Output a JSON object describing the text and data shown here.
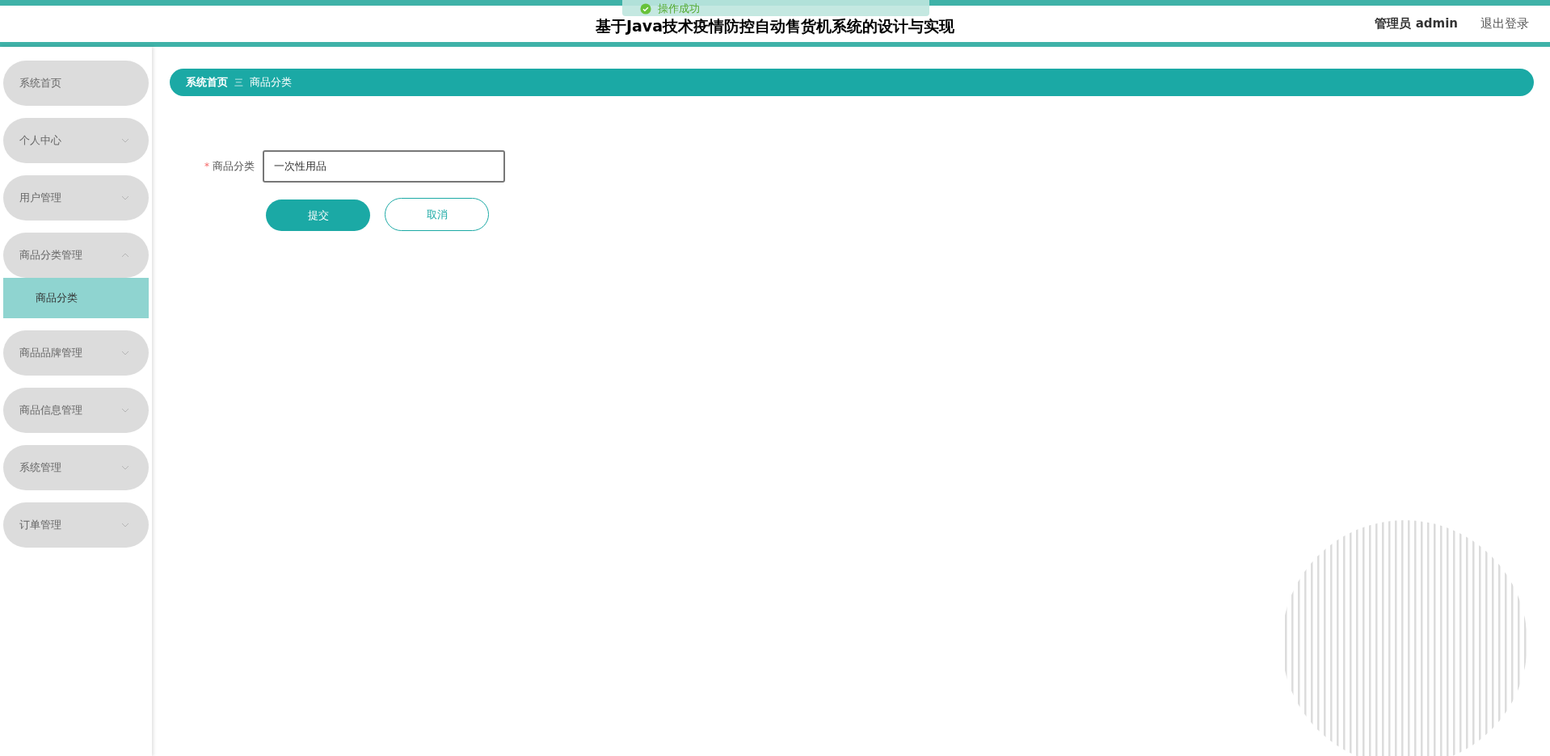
{
  "header": {
    "title": "基于Java技术疫情防控自动售货机系统的设计与实现",
    "user": "管理员 admin",
    "logout": "退出登录"
  },
  "toast": {
    "message": "操作成功"
  },
  "sidebar": {
    "items": [
      {
        "label": "系统首页",
        "kind": "link"
      },
      {
        "label": "个人中心",
        "kind": "menu",
        "expanded": false
      },
      {
        "label": "用户管理",
        "kind": "menu",
        "expanded": false
      },
      {
        "label": "商品分类管理",
        "kind": "menu",
        "expanded": true,
        "children": [
          {
            "label": "商品分类",
            "selected": true
          }
        ]
      },
      {
        "label": "商品品牌管理",
        "kind": "menu",
        "expanded": false
      },
      {
        "label": "商品信息管理",
        "kind": "menu",
        "expanded": false
      },
      {
        "label": "系统管理",
        "kind": "menu",
        "expanded": false
      },
      {
        "label": "订单管理",
        "kind": "menu",
        "expanded": false
      }
    ]
  },
  "breadcrumb": {
    "items": [
      "系统首页",
      "商品分类"
    ],
    "separator": "三"
  },
  "form": {
    "fields": [
      {
        "label": "商品分类",
        "required_mark": "*",
        "value": "一次性用品"
      }
    ],
    "submit": "提交",
    "cancel": "取消"
  }
}
